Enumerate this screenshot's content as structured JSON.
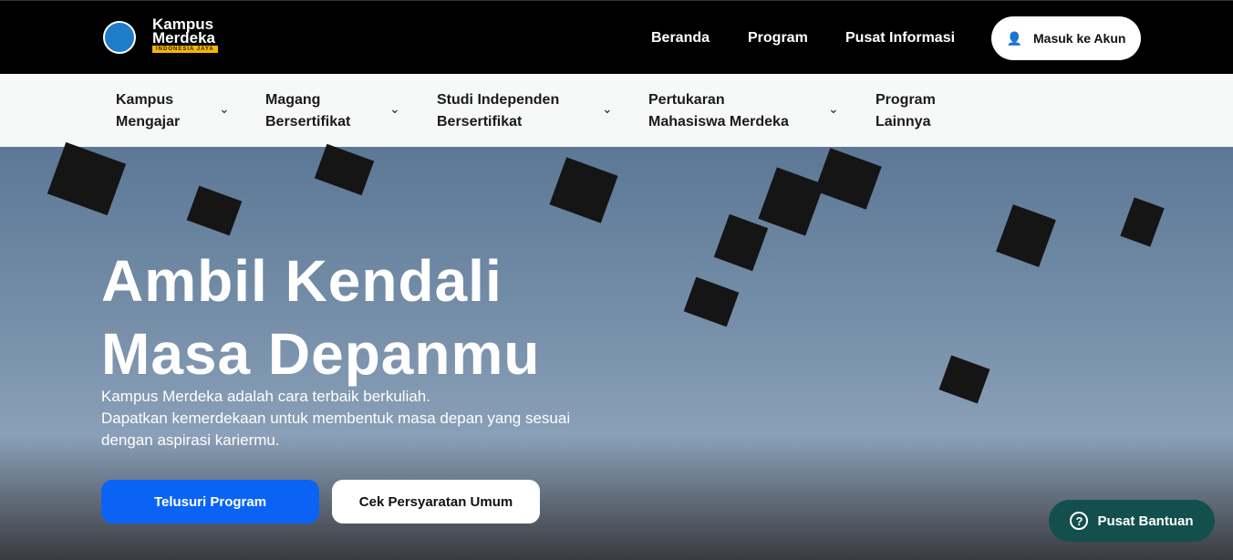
{
  "header": {
    "logo_text_1": "Kampus",
    "logo_text_2": "Merdeka",
    "logo_band": "INDONESIA JAYA",
    "nav": [
      "Beranda",
      "Program",
      "Pusat Informasi"
    ],
    "login_label": "Masuk ke Akun"
  },
  "subnav": [
    {
      "l1": "Kampus",
      "l2": "Mengajar"
    },
    {
      "l1": "Magang",
      "l2": "Bersertifikat"
    },
    {
      "l1": "Studi Independen",
      "l2": "Bersertifikat"
    },
    {
      "l1": "Pertukaran",
      "l2": "Mahasiswa Merdeka"
    },
    {
      "l1": "Program",
      "l2": "Lainnya"
    }
  ],
  "hero": {
    "title_1": "Ambil Kendali",
    "title_2": "Masa Depanmu",
    "desc_1": "Kampus Merdeka adalah cara terbaik berkuliah.",
    "desc_2": "Dapatkan kemerdekaan untuk membentuk masa depan yang sesuai dengan aspirasi kariermu.",
    "primary_label": "Telusuri Program",
    "secondary_label": "Cek Persyaratan Umum"
  },
  "help_label": "Pusat Bantuan",
  "colors": {
    "primary": "#0b63f6",
    "help": "#134f4c"
  }
}
